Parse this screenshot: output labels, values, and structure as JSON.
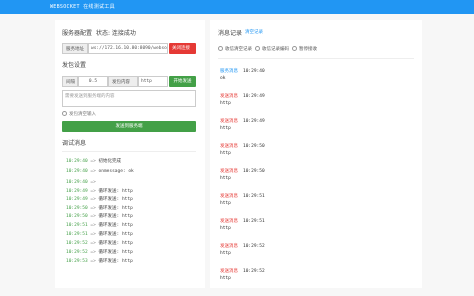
{
  "app": {
    "title": "WEBSOCKET 在线测试工具"
  },
  "server": {
    "section_title": "服务器配置",
    "status_label": "状态: 连接成功",
    "url_label": "服务地址",
    "url_value": "ws://172.16.10.80:8090/websocket",
    "close_button": "关闭连接"
  },
  "send": {
    "section_title": "发包设置",
    "interval_label": "间隔",
    "interval_value": "0.5",
    "content_label": "发包内容",
    "content_value": "http",
    "start_button": "开始发送",
    "textarea_placeholder": "需要发送到服务端的内容",
    "auto_input_label": "发包清空输入",
    "send_button": "发送到服务端"
  },
  "debug": {
    "section_title": "调试消息",
    "lines": [
      {
        "time": "10:29:40",
        "arrow": "=>",
        "text": "初始化完成"
      },
      {
        "time": "10:29:40",
        "arrow": "=>",
        "text": "onmessage: ok"
      },
      {
        "time": "10:29:40",
        "arrow": "=>",
        "text": ""
      },
      {
        "time": "10:29:49",
        "arrow": "=>",
        "text": "循环发送: http"
      },
      {
        "time": "10:29:49",
        "arrow": "=>",
        "text": "循环发送: http"
      },
      {
        "time": "10:29:50",
        "arrow": "=>",
        "text": "循环发送: http"
      },
      {
        "time": "10:29:50",
        "arrow": "=>",
        "text": "循环发送: http"
      },
      {
        "time": "10:29:51",
        "arrow": "=>",
        "text": "循环发送: http"
      },
      {
        "time": "10:29:51",
        "arrow": "=>",
        "text": "循环发送: http"
      },
      {
        "time": "10:29:52",
        "arrow": "=>",
        "text": "循环发送: http"
      },
      {
        "time": "10:29:52",
        "arrow": "=>",
        "text": "循环发送: http"
      },
      {
        "time": "10:29:53",
        "arrow": "=>",
        "text": "循环发送: http"
      }
    ]
  },
  "records": {
    "section_title": "消息记录",
    "clear_link": "清空记录",
    "options": [
      "收信清空记录",
      "收信记录编码",
      "暂停接收"
    ],
    "items": [
      {
        "tag": "服务消息",
        "time": "10:29:40",
        "msg": "ok",
        "color": "#2196f3"
      },
      {
        "tag": "发送消息",
        "time": "10:29:49",
        "msg": "http",
        "color": "#e53935"
      },
      {
        "tag": "发送消息",
        "time": "10:29:49",
        "msg": "http",
        "color": "#e53935"
      },
      {
        "tag": "发送消息",
        "time": "10:29:50",
        "msg": "http",
        "color": "#e53935"
      },
      {
        "tag": "发送消息",
        "time": "10:29:50",
        "msg": "http",
        "color": "#e53935"
      },
      {
        "tag": "发送消息",
        "time": "10:29:51",
        "msg": "http",
        "color": "#e53935"
      },
      {
        "tag": "发送消息",
        "time": "10:29:51",
        "msg": "http",
        "color": "#e53935"
      },
      {
        "tag": "发送消息",
        "time": "10:29:52",
        "msg": "http",
        "color": "#e53935"
      },
      {
        "tag": "发送消息",
        "time": "10:29:52",
        "msg": "http",
        "color": "#e53935"
      }
    ]
  }
}
